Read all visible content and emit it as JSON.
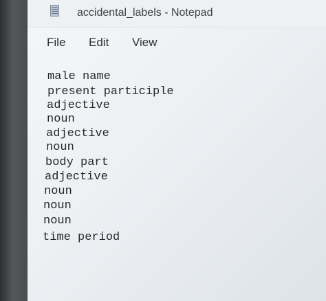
{
  "window": {
    "title": "accidental_labels - Notepad"
  },
  "menu": {
    "file": "File",
    "edit": "Edit",
    "view": "View"
  },
  "editor": {
    "lines": [
      "male name",
      "present participle",
      "adjective",
      "noun",
      "adjective",
      "noun",
      "body part",
      "adjective",
      "noun",
      "noun",
      "noun",
      "time period"
    ]
  },
  "icons": {
    "app": "notepad-icon"
  }
}
